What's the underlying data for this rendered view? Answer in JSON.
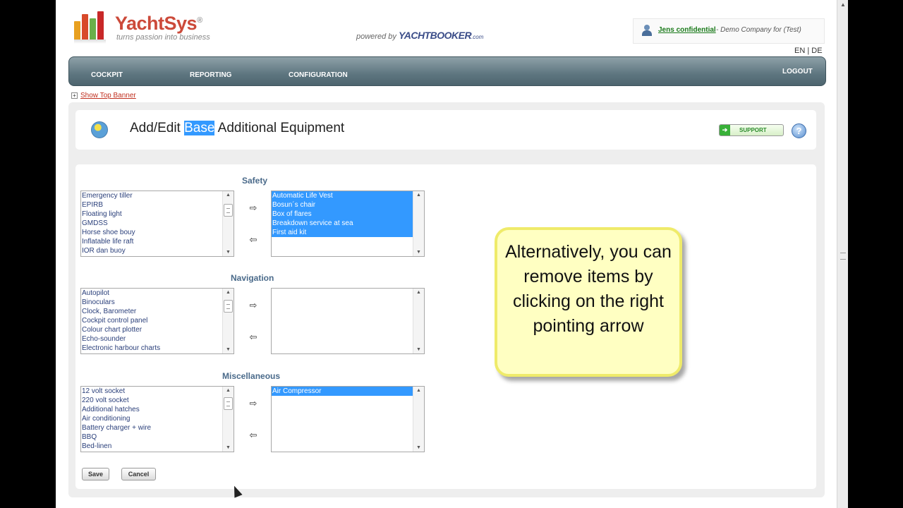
{
  "brand": {
    "name": "YachtSys",
    "reg": "®",
    "tagline": "turns passion into business",
    "powered_prefix": "powered by",
    "powered_name": "YACHTBOOKER",
    "powered_suffix": ".com",
    "logo_colors": [
      "#e8a020",
      "#d84a2a",
      "#6ab04a",
      "#c82828"
    ]
  },
  "user": {
    "icon": "user-icon",
    "name": "Jens confidential",
    "company": "- Demo Company for (Test)"
  },
  "lang": {
    "label": "EN | DE"
  },
  "nav": {
    "items": [
      "COCKPIT",
      "REPORTING",
      "CONFIGURATION"
    ],
    "logout": "LOGOUT"
  },
  "banner_toggle": {
    "icon": "plus-box-icon",
    "label": "Show Top Banner"
  },
  "page": {
    "title_before": "Add/Edit ",
    "title_highlight": "Base",
    "title_after": " Additional Equipment",
    "support_label": "SUPPORT",
    "help_icon": "help-icon"
  },
  "sections": [
    {
      "title": "Safety",
      "available": [
        "Emergency tiller",
        "EPIRB",
        "Floating light",
        "GMDSS",
        "Horse shoe bouy",
        "Inflatable life raft",
        "IOR dan buoy"
      ],
      "selected": [
        "Automatic Life Vest",
        "Bosun´s chair",
        "Box of flares",
        "Breakdown service at sea",
        "First aid kit"
      ]
    },
    {
      "title": "Navigation",
      "available": [
        "Autopilot",
        "Binoculars",
        "Clock, Barometer",
        "Cockpit control panel",
        "Colour chart plotter",
        "Echo-sounder",
        "Electronic harbour charts"
      ],
      "selected": []
    },
    {
      "title": "Miscellaneous",
      "available": [
        "12 volt socket",
        "220 volt socket",
        "Additional hatches",
        "Air conditioning",
        "Battery charger + wire",
        "BBQ",
        "Bed-linen"
      ],
      "selected": [
        "Air Compressor"
      ]
    }
  ],
  "arrows": {
    "add": "⇨",
    "remove": "⇦"
  },
  "buttons": {
    "save": "Save",
    "cancel": "Cancel"
  },
  "callout": {
    "text": "Alternatively, you can remove items by clicking on the right pointing arrow"
  }
}
